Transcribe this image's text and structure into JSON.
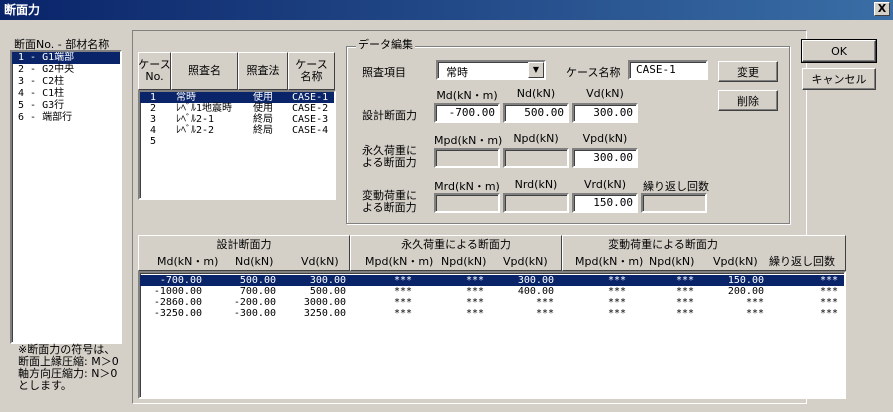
{
  "window": {
    "title": "断面力",
    "close_label": "X"
  },
  "left_panel": {
    "header": "断面No. - 部材名称",
    "items": [
      "1 - G1端部",
      "2 - G2中央",
      "3 - C2柱",
      "4 - C1柱",
      "5 - G3行",
      "6 - 端部行"
    ],
    "note": [
      "※断面力の符号は、",
      "断面上縁圧縮: M＞0",
      "軸方向圧縮力: N＞0",
      "とします。"
    ]
  },
  "case_list": {
    "headers": {
      "case_no": "ケース\nNo.",
      "check_name": "照査名",
      "method": "照査法",
      "case_name": "ケース\n名称"
    },
    "rows": [
      {
        "no": "1",
        "name": "常時",
        "method": "使用",
        "case": "CASE-1"
      },
      {
        "no": "2",
        "name": "ﾚﾍﾞﾙ1地震時",
        "method": "使用",
        "case": "CASE-2"
      },
      {
        "no": "3",
        "name": "ﾚﾍﾞﾙ2-1",
        "method": "終局",
        "case": "CASE-3"
      },
      {
        "no": "4",
        "name": "ﾚﾍﾞﾙ2-2",
        "method": "終局",
        "case": "CASE-4"
      },
      {
        "no": "5",
        "name": "",
        "method": "",
        "case": ""
      }
    ]
  },
  "edit": {
    "group_title": "データ編集",
    "check_item_label": "照査項目",
    "check_item_value": "常時",
    "case_name_label": "ケース名称",
    "case_name_value": "CASE-1",
    "change_button": "変更",
    "delete_button": "削除",
    "design": {
      "label": "設計断面力",
      "md_label": "Md(kN・m)",
      "nd_label": "Nd(kN)",
      "vd_label": "Vd(kN)",
      "md": "-700.00",
      "nd": "500.00",
      "vd": "300.00"
    },
    "permanent": {
      "label": [
        "永久荷重に",
        "よる断面力"
      ],
      "mpd_label": "Mpd(kN・m)",
      "npd_label": "Npd(kN)",
      "vpd_label": "Vpd(kN)",
      "mpd": "",
      "npd": "",
      "vpd": "300.00"
    },
    "variable": {
      "label": [
        "変動荷重に",
        "よる断面力"
      ],
      "mrd_label": "Mrd(kN・m)",
      "nrd_label": "Nrd(kN)",
      "vrd_label": "Vrd(kN)",
      "repeat_label": "繰り返し回数",
      "mrd": "",
      "nrd": "",
      "vrd": "150.00",
      "repeat": ""
    }
  },
  "buttons": {
    "ok": "OK",
    "cancel": "キャンセル"
  },
  "force_table": {
    "group_headers": [
      "設計断面力",
      "永久荷重による断面力",
      "変動荷重による断面力"
    ],
    "columns": [
      "Md(kN・m)",
      "Nd(kN)",
      "Vd(kN)",
      "Mpd(kN・m)",
      "Npd(kN)",
      "Vpd(kN)",
      "Mpd(kN・m)",
      "Npd(kN)",
      "Vpd(kN)",
      "繰り返し回数"
    ],
    "rows": [
      [
        "-700.00",
        "500.00",
        "300.00",
        "***",
        "***",
        "300.00",
        "***",
        "***",
        "150.00",
        "***"
      ],
      [
        "-1000.00",
        "700.00",
        "500.00",
        "***",
        "***",
        "400.00",
        "***",
        "***",
        "200.00",
        "***"
      ],
      [
        "-2860.00",
        "-200.00",
        "3000.00",
        "***",
        "***",
        "***",
        "***",
        "***",
        "***",
        "***"
      ],
      [
        "-3250.00",
        "-300.00",
        "3250.00",
        "***",
        "***",
        "***",
        "***",
        "***",
        "***",
        "***"
      ]
    ]
  }
}
